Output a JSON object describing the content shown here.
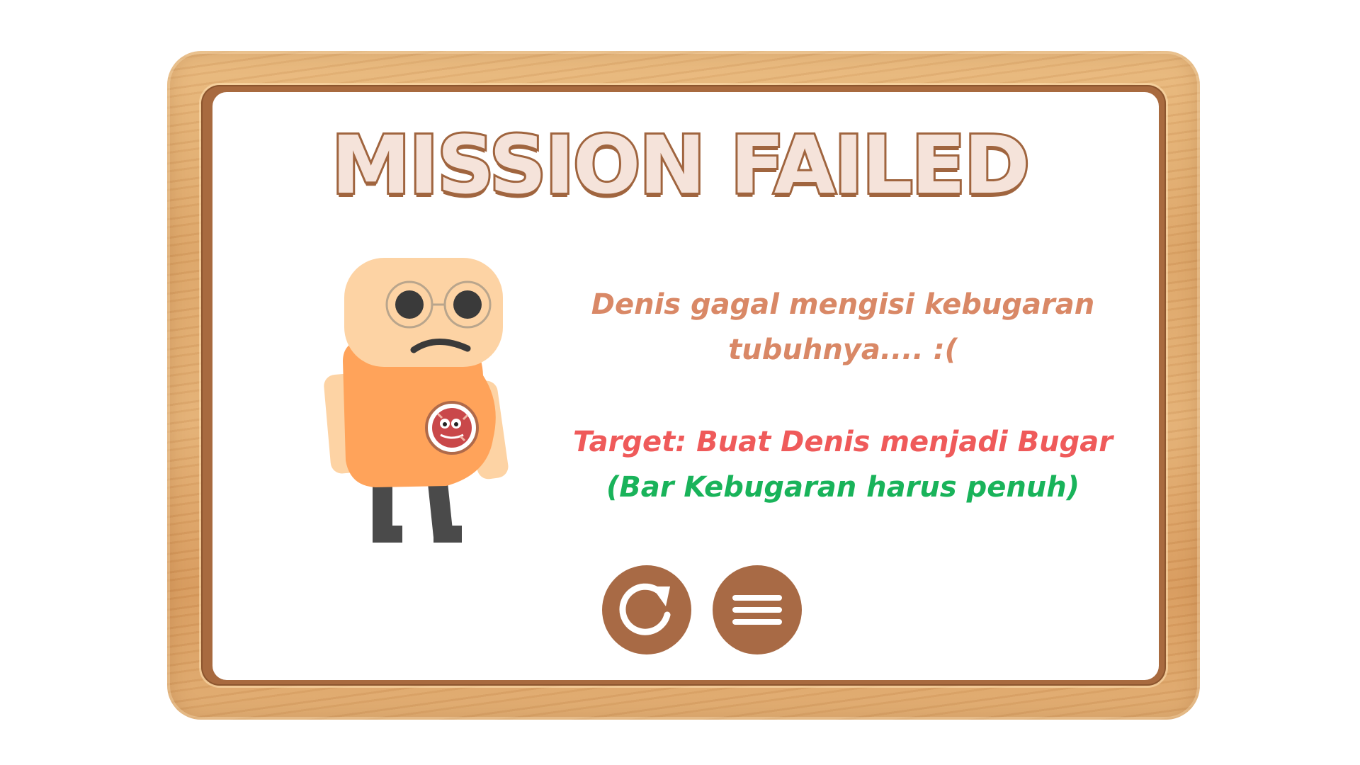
{
  "screen": {
    "title": "MISSION FAILED",
    "message_line1": "Denis gagal mengisi kebugaran",
    "message_line2": "tubuhnya.... :(",
    "target_text": "Target: Buat Denis menjadi Bugar",
    "hint_text": "(Bar Kebugaran harus penuh)"
  },
  "buttons": [
    {
      "id": "restart",
      "icon": "restart-icon"
    },
    {
      "id": "menu",
      "icon": "menu-icon"
    }
  ],
  "colors": {
    "title_fill": "#f5e3da",
    "title_outline": "#a0653f",
    "message": "#d98866",
    "target": "#ef5a5a",
    "hint": "#19b35a",
    "button": "#a86a45",
    "frame_wood": "#dca466"
  },
  "character": {
    "name": "Denis",
    "shirt_badge_icon": "germ-badge-icon"
  }
}
